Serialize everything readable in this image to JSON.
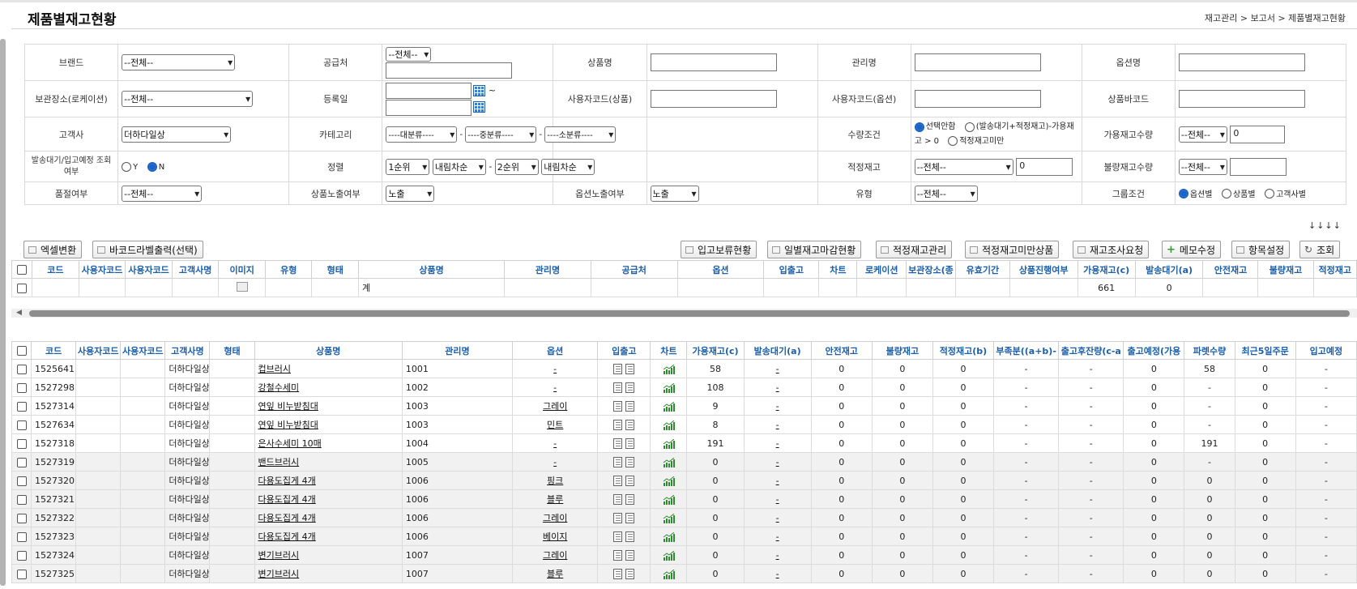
{
  "page": {
    "title": "제품별재고현황",
    "breadcrumb": "재고관리 > 보고서 > 제품별재고현황"
  },
  "filters": {
    "brand": {
      "label": "브랜드",
      "value": "--전체--"
    },
    "supplier": {
      "label": "공급처",
      "value": "--전체--"
    },
    "product_name": {
      "label": "상품명"
    },
    "manage_name": {
      "label": "관리명"
    },
    "option_name": {
      "label": "옵션명"
    },
    "location": {
      "label": "보관장소(로케이션)",
      "value": "--전체--"
    },
    "reg_date": {
      "label": "등록일",
      "sep": "~"
    },
    "user_code_product": {
      "label": "사용자코드(상품)"
    },
    "user_code_option": {
      "label": "사용자코드(옵션)"
    },
    "barcode": {
      "label": "상품바코드"
    },
    "customer": {
      "label": "고객사",
      "value": "더하다일상"
    },
    "category": {
      "label": "카테고리",
      "large": "----대분류----",
      "mid": "----중분류----",
      "small": "----소분류----",
      "dash": "-"
    },
    "qty_condition": {
      "label": "수량조건",
      "opt1": "선택안함",
      "opt2": "(발송대기+적정재고)-가용재고 > 0",
      "opt3": "적정재고미만"
    },
    "avail_qty": {
      "label": "가용재고수량",
      "value": "--전체--",
      "number": "0"
    },
    "shipping_wait": {
      "label": "발송대기/입고예정 조회여부",
      "y": "Y",
      "n": "N"
    },
    "sort": {
      "label": "정렬",
      "p1": "1순위",
      "o1": "내림차순",
      "p2": "2순위",
      "o2": "내림차순",
      "dash": "-"
    },
    "proper_stock": {
      "label": "적정재고",
      "value": "--전체--",
      "number": "0"
    },
    "bad_qty": {
      "label": "불량재고수량",
      "value": "--전체--"
    },
    "soldout": {
      "label": "품절여부",
      "value": "--전체--"
    },
    "product_expose": {
      "label": "상품노출여부",
      "value": "노출"
    },
    "option_expose": {
      "label": "옵션노출여부",
      "value": "노출"
    },
    "type": {
      "label": "유형",
      "value": "--전체--"
    },
    "group": {
      "label": "그룹조건",
      "opt1": "옵션별",
      "opt2": "상품별",
      "opt3": "고객사별"
    },
    "arrows": "↓↓↓↓"
  },
  "buttons": {
    "excel": "엑셀변환",
    "barcode": "바코드라벨출력(선택)",
    "hold": "입고보류현황",
    "daily": "일별재고마감현황",
    "proper": "적정재고관리",
    "under": "적정재고미만상품",
    "survey": "재고조사요청",
    "memo": "메모수정",
    "columns": "항목설정",
    "search": "조회"
  },
  "summary": {
    "headers": [
      "코드",
      "사용자코드",
      "사용자코드",
      "고객사명",
      "이미지",
      "유형",
      "형태",
      "상품명",
      "관리명",
      "공급처",
      "옵션",
      "입출고",
      "차트",
      "로케이션",
      "보관장소(종",
      "유효기간",
      "상품진행여부",
      "가용재고(c)",
      "발송대기(a)",
      "안전재고",
      "불량재고",
      "적정재고"
    ],
    "row": {
      "name": "계",
      "avail": "661",
      "wait": "0"
    }
  },
  "main": {
    "headers": [
      "코드",
      "사용자코드",
      "사용자코드",
      "고객사명",
      "형태",
      "상품명",
      "관리명",
      "옵션",
      "입출고",
      "차트",
      "가용재고(c)",
      "발송대기(a)",
      "안전재고",
      "불량재고",
      "적정재고(b)",
      "부족분((a+b)-",
      "출고후잔량(c-a",
      "출고예정(가용",
      "파렛수량",
      "최근5일주문",
      "입고예정"
    ],
    "rows": [
      {
        "code": "1525641",
        "cust": "더하다일상",
        "name": "컵브러시",
        "mgmt": "1001",
        "opt": "-",
        "avail": "58",
        "wait": "-",
        "safe": "0",
        "bad": "0",
        "proper": "0",
        "short": "-",
        "remain": "-",
        "plan": "0",
        "pallet": "58",
        "recent": "0",
        "inbound": "-"
      },
      {
        "code": "1527298",
        "cust": "더하다일상",
        "name": "강철수세미",
        "mgmt": "1002",
        "opt": "-",
        "avail": "108",
        "wait": "-",
        "safe": "0",
        "bad": "0",
        "proper": "0",
        "short": "-",
        "remain": "-",
        "plan": "0",
        "pallet": "-",
        "recent": "0",
        "inbound": "-"
      },
      {
        "code": "1527314",
        "cust": "더하다일상",
        "name": "연잎 비누받침대",
        "mgmt": "1003",
        "opt": "그레이",
        "avail": "9",
        "wait": "-",
        "safe": "0",
        "bad": "0",
        "proper": "0",
        "short": "-",
        "remain": "-",
        "plan": "0",
        "pallet": "-",
        "recent": "0",
        "inbound": "-"
      },
      {
        "code": "1527634",
        "cust": "더하다일상",
        "name": "연잎 비누받침대",
        "mgmt": "1003",
        "opt": "민트",
        "avail": "8",
        "wait": "-",
        "safe": "0",
        "bad": "0",
        "proper": "0",
        "short": "-",
        "remain": "-",
        "plan": "0",
        "pallet": "-",
        "recent": "0",
        "inbound": "-"
      },
      {
        "code": "1527318",
        "cust": "더하다일상",
        "name": "은사수세미 10매",
        "mgmt": "1004",
        "opt": "-",
        "avail": "191",
        "wait": "-",
        "safe": "0",
        "bad": "0",
        "proper": "0",
        "short": "-",
        "remain": "-",
        "plan": "0",
        "pallet": "191",
        "recent": "0",
        "inbound": "-"
      },
      {
        "code": "1527319",
        "cust": "더하다일상",
        "name": "밴드브러시",
        "mgmt": "1005",
        "opt": "-",
        "avail": "0",
        "wait": "-",
        "safe": "0",
        "bad": "0",
        "proper": "0",
        "short": "-",
        "remain": "-",
        "plan": "0",
        "pallet": "-",
        "recent": "0",
        "inbound": "-"
      },
      {
        "code": "1527320",
        "cust": "더하다일상",
        "name": "다용도집게 4개",
        "mgmt": "1006",
        "opt": "핑크",
        "avail": "0",
        "wait": "-",
        "safe": "0",
        "bad": "0",
        "proper": "0",
        "short": "-",
        "remain": "-",
        "plan": "0",
        "pallet": "0",
        "recent": "0",
        "inbound": "-"
      },
      {
        "code": "1527321",
        "cust": "더하다일상",
        "name": "다용도집게 4개",
        "mgmt": "1006",
        "opt": "블루",
        "avail": "0",
        "wait": "-",
        "safe": "0",
        "bad": "0",
        "proper": "0",
        "short": "-",
        "remain": "-",
        "plan": "0",
        "pallet": "0",
        "recent": "0",
        "inbound": "-"
      },
      {
        "code": "1527322",
        "cust": "더하다일상",
        "name": "다용도집게 4개",
        "mgmt": "1006",
        "opt": "그레이",
        "avail": "0",
        "wait": "-",
        "safe": "0",
        "bad": "0",
        "proper": "0",
        "short": "-",
        "remain": "-",
        "plan": "0",
        "pallet": "0",
        "recent": "0",
        "inbound": "-"
      },
      {
        "code": "1527323",
        "cust": "더하다일상",
        "name": "다용도집게 4개",
        "mgmt": "1006",
        "opt": "베이지",
        "avail": "0",
        "wait": "-",
        "safe": "0",
        "bad": "0",
        "proper": "0",
        "short": "-",
        "remain": "-",
        "plan": "0",
        "pallet": "0",
        "recent": "0",
        "inbound": "-"
      },
      {
        "code": "1527324",
        "cust": "더하다일상",
        "name": "변기브러시",
        "mgmt": "1007",
        "opt": "그레이",
        "avail": "0",
        "wait": "-",
        "safe": "0",
        "bad": "0",
        "proper": "0",
        "short": "-",
        "remain": "-",
        "plan": "0",
        "pallet": "0",
        "recent": "0",
        "inbound": "-"
      },
      {
        "code": "1527325",
        "cust": "더하다일상",
        "name": "변기브러시",
        "mgmt": "1007",
        "opt": "블루",
        "avail": "0",
        "wait": "-",
        "safe": "0",
        "bad": "0",
        "proper": "0",
        "short": "-",
        "remain": "-",
        "plan": "0",
        "pallet": "0",
        "recent": "0",
        "inbound": "-"
      }
    ]
  },
  "colors": {
    "header_text": "#1c5ea8",
    "chart_icon": "#2e8b2e",
    "radio_on": "#1a63c7"
  }
}
